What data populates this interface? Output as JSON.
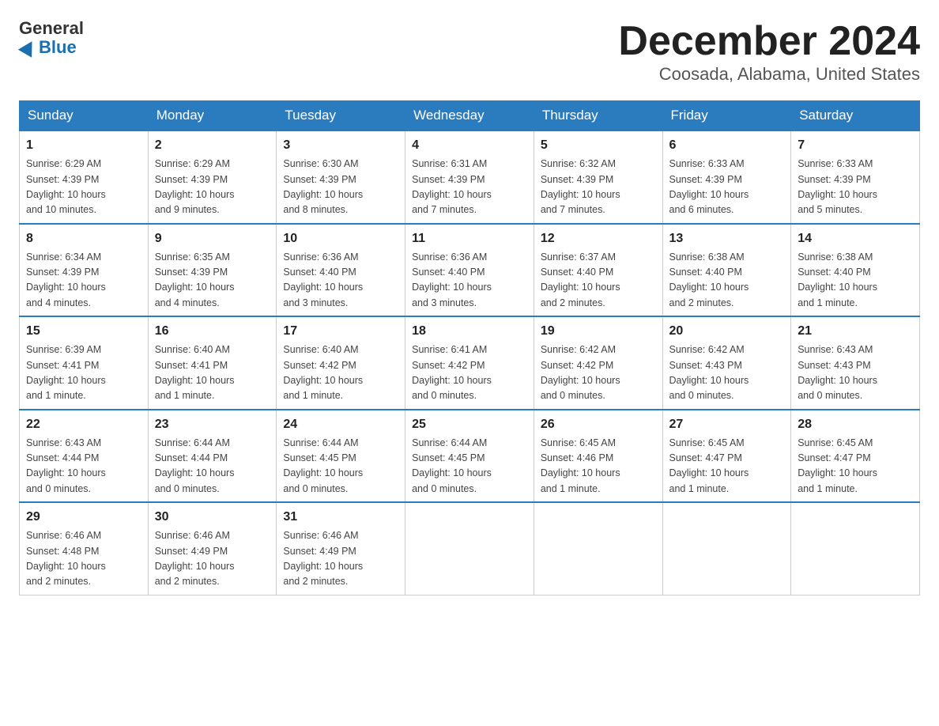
{
  "header": {
    "logo_general": "General",
    "logo_blue": "Blue",
    "month_title": "December 2024",
    "location": "Coosada, Alabama, United States"
  },
  "weekdays": [
    "Sunday",
    "Monday",
    "Tuesday",
    "Wednesday",
    "Thursday",
    "Friday",
    "Saturday"
  ],
  "weeks": [
    [
      {
        "day": "1",
        "sunrise": "6:29 AM",
        "sunset": "4:39 PM",
        "daylight": "10 hours and 10 minutes."
      },
      {
        "day": "2",
        "sunrise": "6:29 AM",
        "sunset": "4:39 PM",
        "daylight": "10 hours and 9 minutes."
      },
      {
        "day": "3",
        "sunrise": "6:30 AM",
        "sunset": "4:39 PM",
        "daylight": "10 hours and 8 minutes."
      },
      {
        "day": "4",
        "sunrise": "6:31 AM",
        "sunset": "4:39 PM",
        "daylight": "10 hours and 7 minutes."
      },
      {
        "day": "5",
        "sunrise": "6:32 AM",
        "sunset": "4:39 PM",
        "daylight": "10 hours and 7 minutes."
      },
      {
        "day": "6",
        "sunrise": "6:33 AM",
        "sunset": "4:39 PM",
        "daylight": "10 hours and 6 minutes."
      },
      {
        "day": "7",
        "sunrise": "6:33 AM",
        "sunset": "4:39 PM",
        "daylight": "10 hours and 5 minutes."
      }
    ],
    [
      {
        "day": "8",
        "sunrise": "6:34 AM",
        "sunset": "4:39 PM",
        "daylight": "10 hours and 4 minutes."
      },
      {
        "day": "9",
        "sunrise": "6:35 AM",
        "sunset": "4:39 PM",
        "daylight": "10 hours and 4 minutes."
      },
      {
        "day": "10",
        "sunrise": "6:36 AM",
        "sunset": "4:40 PM",
        "daylight": "10 hours and 3 minutes."
      },
      {
        "day": "11",
        "sunrise": "6:36 AM",
        "sunset": "4:40 PM",
        "daylight": "10 hours and 3 minutes."
      },
      {
        "day": "12",
        "sunrise": "6:37 AM",
        "sunset": "4:40 PM",
        "daylight": "10 hours and 2 minutes."
      },
      {
        "day": "13",
        "sunrise": "6:38 AM",
        "sunset": "4:40 PM",
        "daylight": "10 hours and 2 minutes."
      },
      {
        "day": "14",
        "sunrise": "6:38 AM",
        "sunset": "4:40 PM",
        "daylight": "10 hours and 1 minute."
      }
    ],
    [
      {
        "day": "15",
        "sunrise": "6:39 AM",
        "sunset": "4:41 PM",
        "daylight": "10 hours and 1 minute."
      },
      {
        "day": "16",
        "sunrise": "6:40 AM",
        "sunset": "4:41 PM",
        "daylight": "10 hours and 1 minute."
      },
      {
        "day": "17",
        "sunrise": "6:40 AM",
        "sunset": "4:42 PM",
        "daylight": "10 hours and 1 minute."
      },
      {
        "day": "18",
        "sunrise": "6:41 AM",
        "sunset": "4:42 PM",
        "daylight": "10 hours and 0 minutes."
      },
      {
        "day": "19",
        "sunrise": "6:42 AM",
        "sunset": "4:42 PM",
        "daylight": "10 hours and 0 minutes."
      },
      {
        "day": "20",
        "sunrise": "6:42 AM",
        "sunset": "4:43 PM",
        "daylight": "10 hours and 0 minutes."
      },
      {
        "day": "21",
        "sunrise": "6:43 AM",
        "sunset": "4:43 PM",
        "daylight": "10 hours and 0 minutes."
      }
    ],
    [
      {
        "day": "22",
        "sunrise": "6:43 AM",
        "sunset": "4:44 PM",
        "daylight": "10 hours and 0 minutes."
      },
      {
        "day": "23",
        "sunrise": "6:44 AM",
        "sunset": "4:44 PM",
        "daylight": "10 hours and 0 minutes."
      },
      {
        "day": "24",
        "sunrise": "6:44 AM",
        "sunset": "4:45 PM",
        "daylight": "10 hours and 0 minutes."
      },
      {
        "day": "25",
        "sunrise": "6:44 AM",
        "sunset": "4:45 PM",
        "daylight": "10 hours and 0 minutes."
      },
      {
        "day": "26",
        "sunrise": "6:45 AM",
        "sunset": "4:46 PM",
        "daylight": "10 hours and 1 minute."
      },
      {
        "day": "27",
        "sunrise": "6:45 AM",
        "sunset": "4:47 PM",
        "daylight": "10 hours and 1 minute."
      },
      {
        "day": "28",
        "sunrise": "6:45 AM",
        "sunset": "4:47 PM",
        "daylight": "10 hours and 1 minute."
      }
    ],
    [
      {
        "day": "29",
        "sunrise": "6:46 AM",
        "sunset": "4:48 PM",
        "daylight": "10 hours and 2 minutes."
      },
      {
        "day": "30",
        "sunrise": "6:46 AM",
        "sunset": "4:49 PM",
        "daylight": "10 hours and 2 minutes."
      },
      {
        "day": "31",
        "sunrise": "6:46 AM",
        "sunset": "4:49 PM",
        "daylight": "10 hours and 2 minutes."
      },
      null,
      null,
      null,
      null
    ]
  ],
  "labels": {
    "sunrise": "Sunrise:",
    "sunset": "Sunset:",
    "daylight": "Daylight:"
  }
}
